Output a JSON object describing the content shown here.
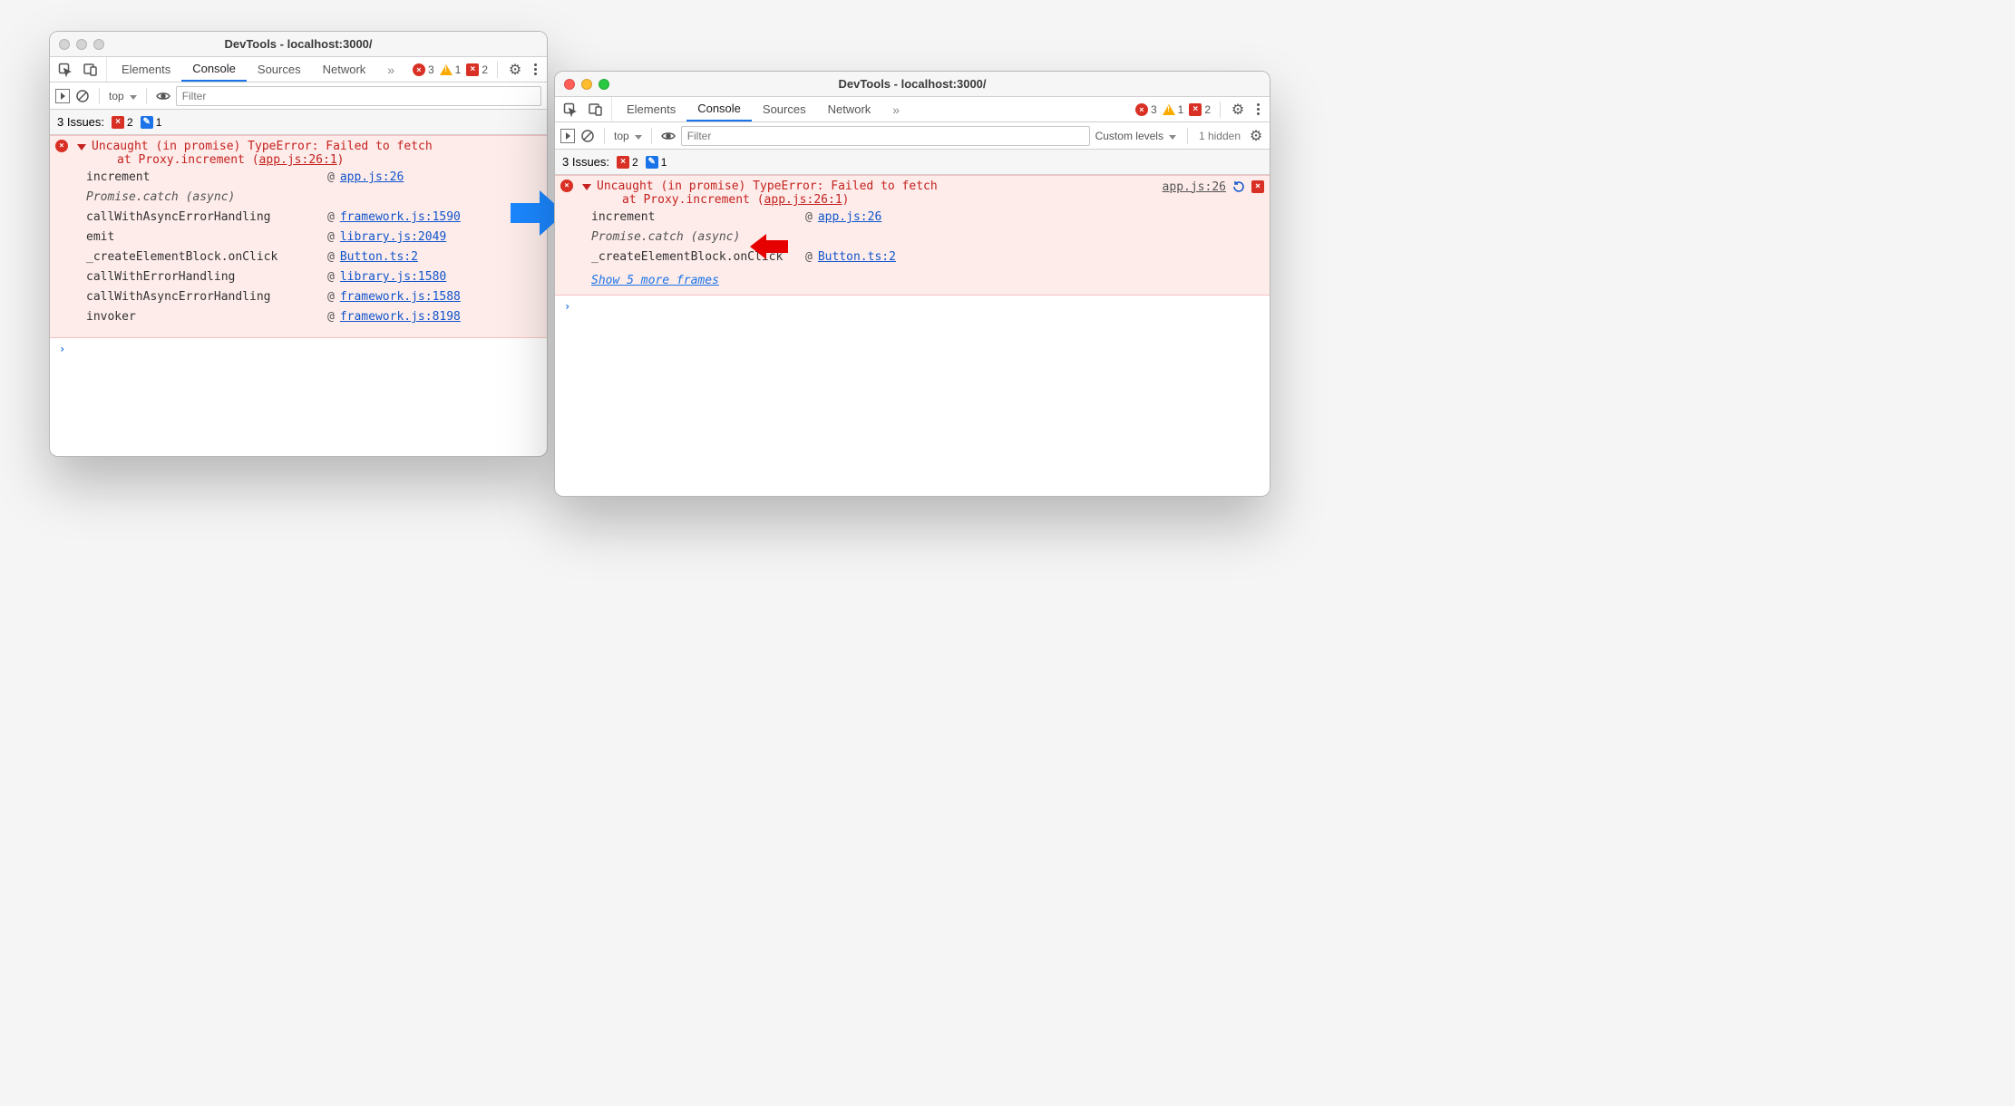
{
  "left": {
    "title": "DevTools - localhost:3000/",
    "tabs": [
      "Elements",
      "Console",
      "Sources",
      "Network"
    ],
    "active_tab": "Console",
    "error_count": "3",
    "warn_count": "1",
    "cross_count": "2",
    "context": "top",
    "filter_placeholder": "Filter",
    "issues_label": "3 Issues:",
    "issues_red": "2",
    "issues_blue": "1",
    "error": {
      "msg_line1": "Uncaught (in promise) TypeError: Failed to fetch",
      "msg_line2_prefix": "at Proxy.increment (",
      "msg_line2_link": "app.js:26:1",
      "msg_line2_suffix": ")"
    },
    "frames": [
      {
        "fn": "increment",
        "at": "@",
        "loc": "app.js:26"
      },
      {
        "fn": "Promise.catch (async)",
        "italic": true
      },
      {
        "fn": "callWithAsyncErrorHandling",
        "at": "@",
        "loc": "framework.js:1590"
      },
      {
        "fn": "emit",
        "at": "@",
        "loc": "library.js:2049"
      },
      {
        "fn": "_createElementBlock.onClick",
        "at": "@",
        "loc": "Button.ts:2"
      },
      {
        "fn": "callWithErrorHandling",
        "at": "@",
        "loc": "library.js:1580"
      },
      {
        "fn": "callWithAsyncErrorHandling",
        "at": "@",
        "loc": "framework.js:1588"
      },
      {
        "fn": "invoker",
        "at": "@",
        "loc": "framework.js:8198"
      }
    ]
  },
  "right": {
    "title": "DevTools - localhost:3000/",
    "tabs": [
      "Elements",
      "Console",
      "Sources",
      "Network"
    ],
    "active_tab": "Console",
    "error_count": "3",
    "warn_count": "1",
    "cross_count": "2",
    "context": "top",
    "filter_placeholder": "Filter",
    "levels": "Custom levels",
    "hidden": "1 hidden",
    "issues_label": "3 Issues:",
    "issues_red": "2",
    "issues_blue": "1",
    "error": {
      "msg_line1": "Uncaught (in promise) TypeError: Failed to fetch",
      "msg_line2_prefix": "at Proxy.increment (",
      "msg_line2_link": "app.js:26:1",
      "msg_line2_suffix": ")",
      "src": "app.js:26"
    },
    "frames": [
      {
        "fn": "increment",
        "at": "@",
        "loc": "app.js:26"
      },
      {
        "fn": "Promise.catch (async)",
        "italic": true
      },
      {
        "fn": "_createElementBlock.onClick",
        "at": "@",
        "loc": "Button.ts:2"
      }
    ],
    "show_more": "Show 5 more frames"
  }
}
